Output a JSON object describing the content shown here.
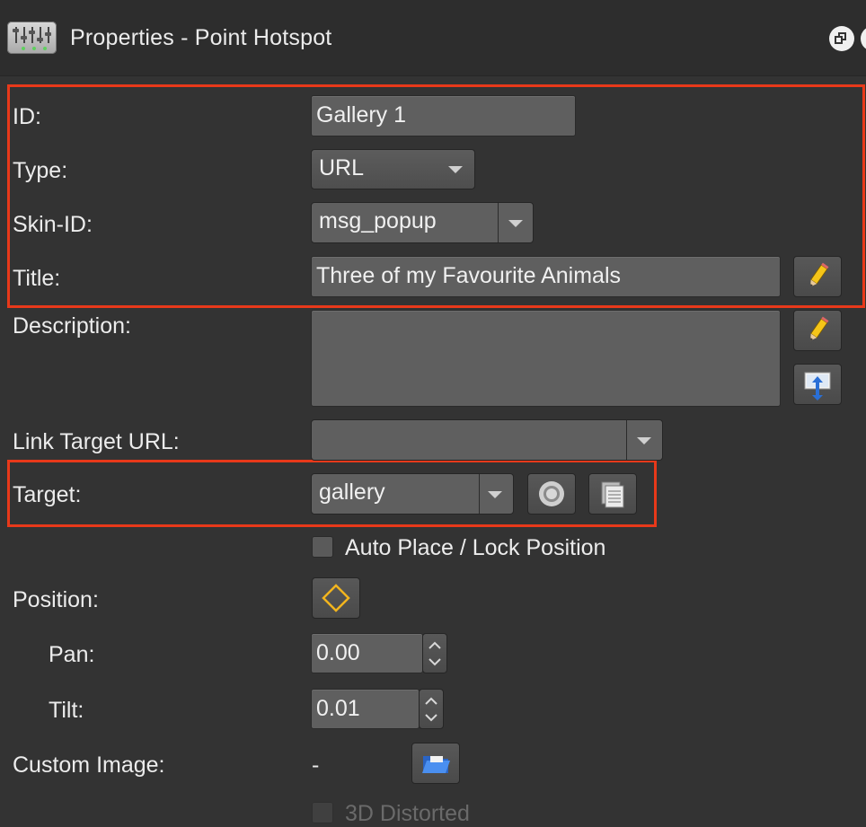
{
  "header": {
    "title": "Properties - Point Hotspot"
  },
  "form": {
    "id": {
      "label": "ID:",
      "value": "Gallery 1"
    },
    "type": {
      "label": "Type:",
      "value": "URL"
    },
    "skin_id": {
      "label": "Skin-ID:",
      "value": "msg_popup"
    },
    "title": {
      "label": "Title:",
      "value": "Three of my Favourite Animals"
    },
    "description": {
      "label": "Description:",
      "value": ""
    },
    "link_target_url": {
      "label": "Link Target URL:",
      "value": ""
    },
    "target": {
      "label": "Target:",
      "value": "gallery"
    },
    "auto_place": {
      "label": "Auto Place / Lock Position",
      "checked": false
    },
    "position": {
      "label": "Position:"
    },
    "pan": {
      "label": "Pan:",
      "value": "0.00"
    },
    "tilt": {
      "label": "Tilt:",
      "value": "0.01"
    },
    "custom_image": {
      "label": "Custom Image:",
      "value": "-"
    },
    "distorted": {
      "label": "3D Distorted"
    }
  },
  "colors": {
    "highlight": "#e8391a",
    "background": "#333333",
    "field": "#5f5f5f"
  },
  "icons": [
    "app-properties-icon",
    "float-window-icon",
    "pencil-icon",
    "import-icon",
    "target-pick-icon",
    "copy-icon",
    "diamond-position-icon",
    "folder-open-icon"
  ]
}
